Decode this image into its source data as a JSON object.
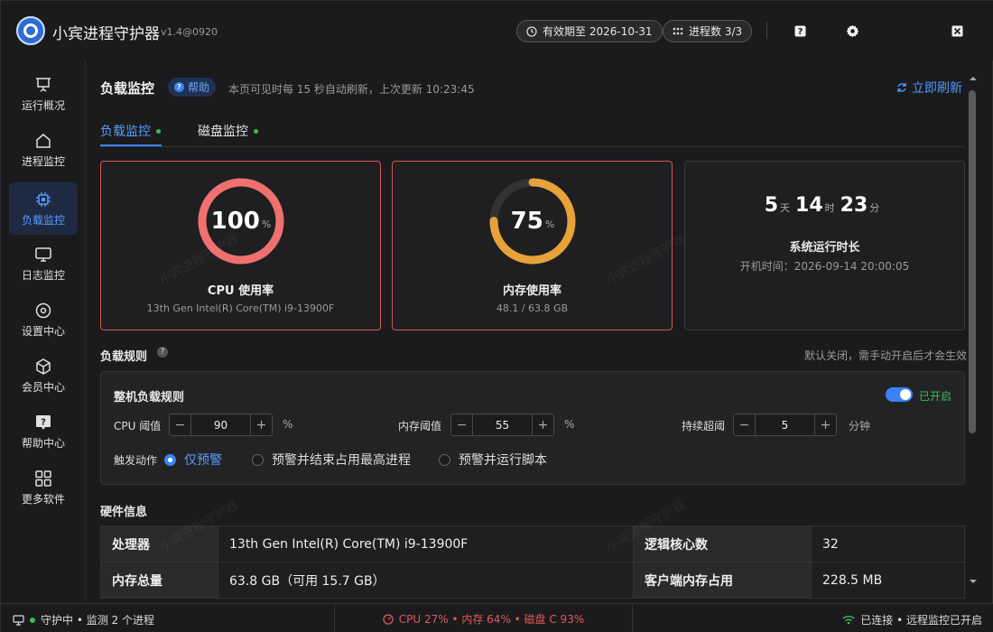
{
  "app": {
    "title": "小宾进程守护器",
    "version": "v1.4@0920"
  },
  "header": {
    "validity": "有效期至 2026-10-31",
    "process_count": "进程数 3/3"
  },
  "sidebar": {
    "items": [
      {
        "label": "运行概况",
        "icon": "presentation-icon"
      },
      {
        "label": "进程监控",
        "icon": "home-icon"
      },
      {
        "label": "负载监控",
        "icon": "chip-icon"
      },
      {
        "label": "日志监控",
        "icon": "monitor-icon"
      },
      {
        "label": "设置中心",
        "icon": "settings-icon"
      },
      {
        "label": "会员中心",
        "icon": "cube-icon"
      },
      {
        "label": "帮助中心",
        "icon": "help-icon"
      },
      {
        "label": "更多软件",
        "icon": "grid-icon"
      }
    ]
  },
  "page": {
    "title": "负载监控",
    "help": "帮助",
    "note": "本页可见时每 15 秒自动刷新，上次更新 10:23:45",
    "refresh": "立即刷新",
    "tabs": [
      {
        "label": "负载监控"
      },
      {
        "label": "磁盘监控"
      }
    ]
  },
  "cards": {
    "cpu": {
      "value": "100",
      "unit": "%",
      "percent": 100,
      "title": "CPU 使用率",
      "sub": "13th Gen Intel(R) Core(TM) i9-13900F",
      "color": "#f07070"
    },
    "mem": {
      "value": "75",
      "unit": "%",
      "percent": 75,
      "title": "内存使用率",
      "sub": "48.1 / 63.8 GB",
      "color": "#e8a23a"
    },
    "uptime": {
      "days": "5",
      "days_unit": "天",
      "hours": "14",
      "hours_unit": "时",
      "mins": "23",
      "mins_unit": "分",
      "title": "系统运行时长",
      "sub": "开机时间：2026-09-14 20:00:05"
    }
  },
  "rules": {
    "section_title": "负载规则",
    "note": "默认关闭，需手动开启后才会生效",
    "panel_title": "整机负载规则",
    "toggle_label": "已开启",
    "cpu_label": "CPU 阈值",
    "cpu_value": "90",
    "cpu_unit": "%",
    "mem_label": "内存阈值",
    "mem_value": "55",
    "mem_unit": "%",
    "dur_label": "持续超阈",
    "dur_value": "5",
    "dur_unit": "分钟",
    "action_label": "触发动作",
    "actions": [
      "仅预警",
      "预警并结束占用最高进程",
      "预警并运行脚本"
    ],
    "minus": "−",
    "plus": "+"
  },
  "hardware": {
    "title": "硬件信息",
    "rows": [
      {
        "k1": "处理器",
        "v1": "13th Gen Intel(R) Core(TM) i9-13900F",
        "k2": "逻辑核心数",
        "v2": "32"
      },
      {
        "k1": "内存总量",
        "v1": "63.8 GB（可用 15.7 GB）",
        "k2": "客户端内存占用",
        "v2": "228.5 MB"
      }
    ]
  },
  "status": {
    "left": "守护中 • 监测 2 个进程",
    "center": "CPU 27% • 内存 64% • 磁盘 C 93%",
    "right": "已连接 • 远程监控已开启"
  },
  "watermark": "小宾进程守护器"
}
